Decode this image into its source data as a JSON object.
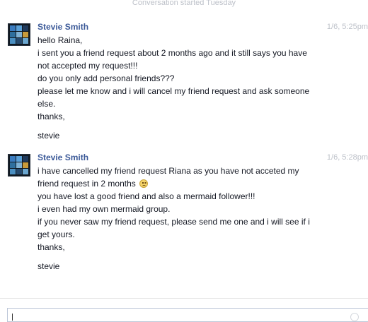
{
  "conversation": {
    "started_label": "Conversation started Tuesday"
  },
  "messages": [
    {
      "sender": "Stevie Smith",
      "time": "1/6, 5:25pm",
      "lines": [
        "hello Raina,",
        "i sent you a friend request about 2 months ago and it still says you have",
        "not accepted my request!!!",
        "do you only add personal friends???",
        "please let me know and i will cancel my friend request and ask someone",
        "else.",
        "thanks,",
        "",
        "stevie"
      ]
    },
    {
      "sender": "Stevie Smith",
      "time": "1/6, 5:28pm",
      "lines": [
        "i have cancelled my friend request Riana as you have not acceted my",
        "friend request in 2 months",
        "you have lost a good friend and also a mermaid follower!!!",
        "i even had my own mermaid group.",
        "if you never saw my friend request, please send me one and i will see if i",
        "get yours.",
        "thanks,",
        "",
        "stevie"
      ],
      "emoticon": "frown-emoticon-icon"
    }
  ],
  "composer": {
    "value": "",
    "emoji_icon": "emoji-icon"
  },
  "colors": {
    "sender_name": "#3b5998",
    "meta_text": "#bdc1c9",
    "body_text": "#141823"
  }
}
